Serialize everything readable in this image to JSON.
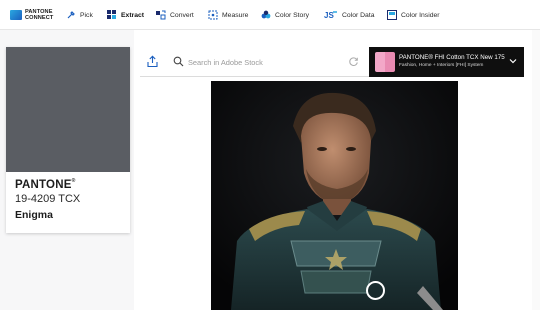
{
  "app": {
    "logo_line1": "PANTONE",
    "logo_line2": "CONNECT"
  },
  "toolbar": {
    "items": [
      {
        "label": "Pick",
        "icon": "eyedropper-icon"
      },
      {
        "label": "Extract",
        "icon": "extract-grid-icon",
        "active": true
      },
      {
        "label": "Convert",
        "icon": "convert-icon"
      },
      {
        "label": "Measure",
        "icon": "measure-icon"
      },
      {
        "label": "Color Story",
        "icon": "color-story-icon"
      },
      {
        "label": "Color Data",
        "icon": "color-data-icon"
      },
      {
        "label": "Color Insider",
        "icon": "color-insider-icon"
      }
    ]
  },
  "selected_color": {
    "brand": "PANTONE",
    "registered": "®",
    "code": "19-4209 TCX",
    "name": "Enigma",
    "hex": "#5a5d63"
  },
  "search": {
    "placeholder": "Search in Adobe Stock",
    "value": ""
  },
  "library": {
    "title": "PANTONE® FHI Cotton TCX New 175",
    "subtitle": "Fashion, Home + Interiors [FHI] System",
    "swatch_colors": [
      "#f3a8c8",
      "#e98bb2"
    ]
  },
  "colors": {
    "swatch_bg": "#5a5d63",
    "accent_blue": "#1b5fbf",
    "dropdown_bg": "#0f0f0f"
  }
}
